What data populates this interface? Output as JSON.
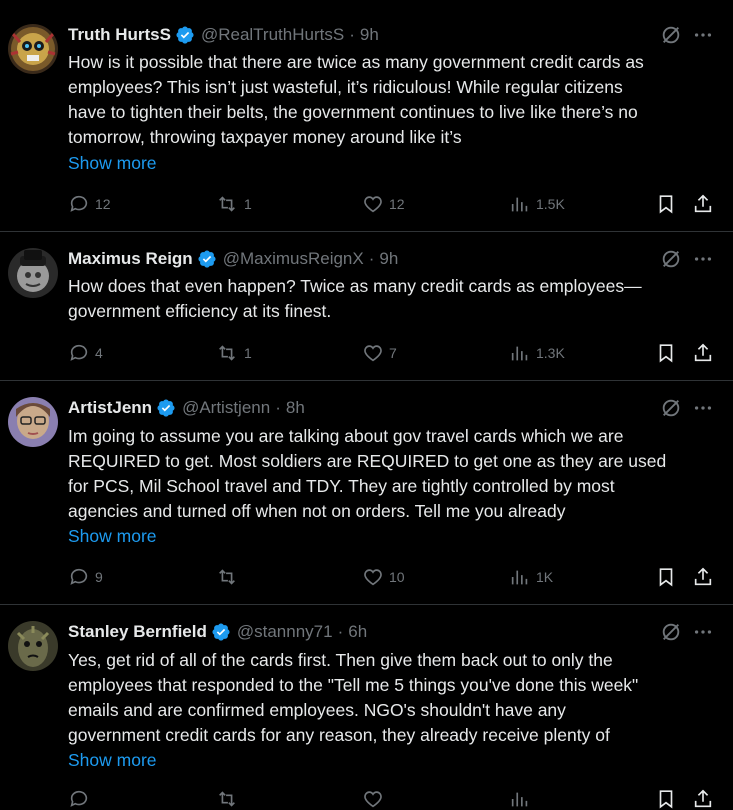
{
  "tweets": [
    {
      "name": "Truth HurtsS",
      "handle": "@RealTruthHurtsS",
      "separator": "·",
      "time": "9h",
      "lines": [
        "How is it possible that there are twice as many government credit cards as",
        "employees? This isn’t just wasteful, it’s ridiculous! While regular citizens",
        "have to tighten their belts, the government continues to live like there’s no",
        "tomorrow, throwing taxpayer money around like it’s"
      ],
      "show_more": "Show more",
      "replies": "12",
      "reposts": "1",
      "likes": "12",
      "views": "1.5K"
    },
    {
      "name": "Maximus Reign",
      "handle": "@MaximusReignX",
      "separator": "·",
      "time": "9h",
      "lines": [
        "How does that even happen? Twice as many credit cards as employees—",
        "government efficiency at its finest."
      ],
      "show_more": "",
      "replies": "4",
      "reposts": "1",
      "likes": "7",
      "views": "1.3K"
    },
    {
      "name": "ArtistJenn",
      "handle": "@Artistjenn",
      "separator": "·",
      "time": "8h",
      "lines": [
        "Im going to assume you are talking about gov travel cards which we are",
        "REQUIRED to get. Most soldiers are REQUIRED to get one as they are used",
        "for PCS, Mil School travel and TDY. They are tightly controlled by most",
        "agencies and turned off when not on orders. Tell me you already"
      ],
      "show_more": "Show more",
      "replies": "9",
      "reposts": "",
      "likes": "10",
      "views": "1K"
    },
    {
      "name": "Stanley Bernfield",
      "handle": "@stannny71",
      "separator": "·",
      "time": "6h",
      "lines": [
        "Yes, get rid of all of the cards first. Then give them back out to only the",
        "employees that responded to the \"Tell me 5 things you've done this week\"",
        "emails and are confirmed employees. NGO's shouldn't have any",
        "government credit cards for any reason, they already receive plenty of"
      ],
      "show_more": "Show more"
    }
  ],
  "colors": {
    "background": "#000000",
    "text": "#e7e9ea",
    "muted": "#71767b",
    "link": "#1d9bf0",
    "verified": "#1d9bf0",
    "divider": "#2f3336"
  }
}
